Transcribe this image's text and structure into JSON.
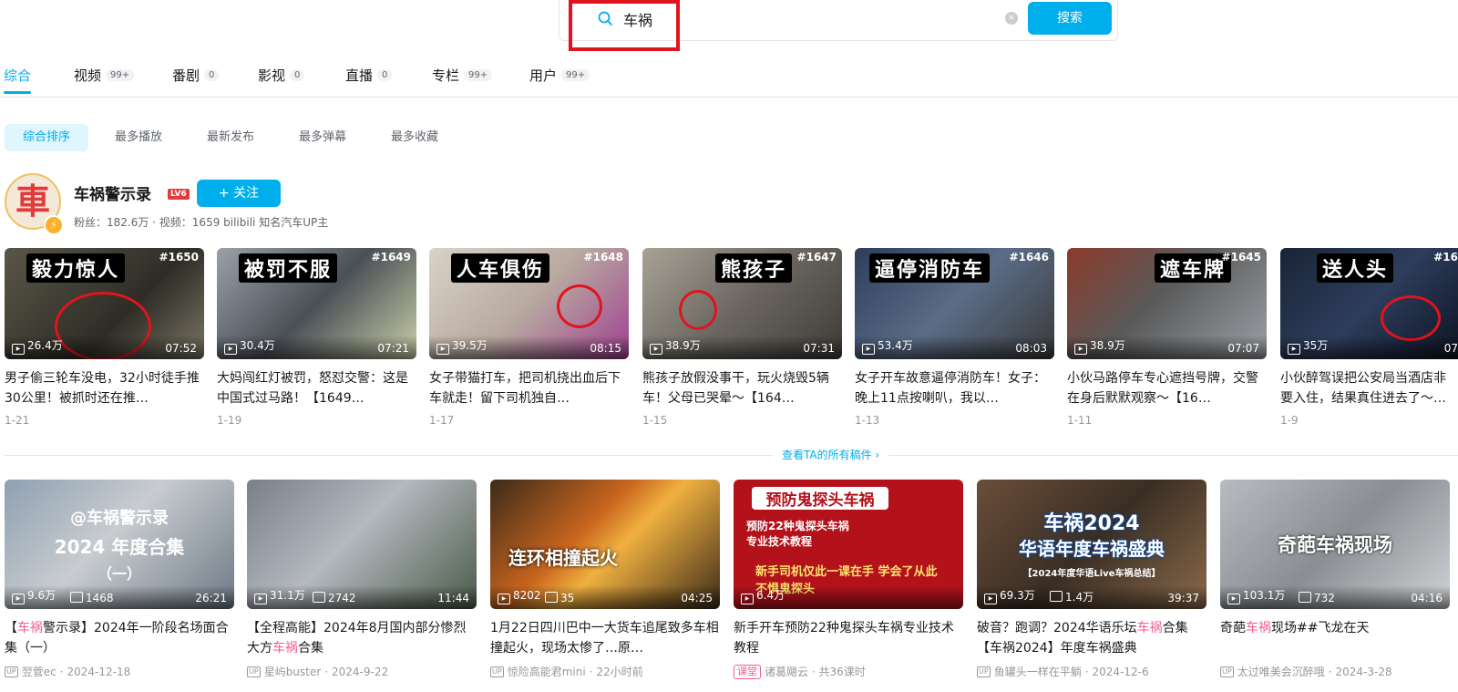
{
  "search": {
    "query": "车祸",
    "clear_label": "×",
    "button_label": "搜索"
  },
  "tabs": [
    {
      "label": "综合",
      "count": ""
    },
    {
      "label": "视频",
      "count": "99+"
    },
    {
      "label": "番剧",
      "count": "0"
    },
    {
      "label": "影视",
      "count": "0"
    },
    {
      "label": "直播",
      "count": "0"
    },
    {
      "label": "专栏",
      "count": "99+"
    },
    {
      "label": "用户",
      "count": "99+"
    }
  ],
  "sort_options": [
    "综合排序",
    "最多播放",
    "最新发布",
    "最多弹幕",
    "最多收藏"
  ],
  "uploader": {
    "avatar_char": "車",
    "name": "车祸警示录",
    "level": "LV6",
    "follow_label": "+ 关注",
    "stats": "粉丝：182.6万 · 视频：1659  bilibili 知名汽车UP主"
  },
  "uploader_videos": [
    {
      "caption": "毅力惊人",
      "num": "#1650",
      "plays": "26.4万",
      "duration": "07:52",
      "title": "男子偷三轮车没电，32小时徒手推30公里！被抓时还在推…",
      "date": "1-21"
    },
    {
      "caption": "被罚不服",
      "num": "#1649",
      "plays": "30.4万",
      "duration": "07:21",
      "title": "大妈闯红灯被罚，怒怼交警：这是中国式过马路！【1649…",
      "date": "1-19"
    },
    {
      "caption": "人车俱伤",
      "num": "#1648",
      "plays": "39.5万",
      "duration": "08:15",
      "title": "女子带猫打车，把司机挠出血后下车就走！留下司机独自…",
      "date": "1-17"
    },
    {
      "caption": "熊孩子",
      "num": "#1647",
      "plays": "38.9万",
      "duration": "07:31",
      "title": "熊孩子放假没事干，玩火烧毁5辆车！父母已哭晕～【164…",
      "date": "1-15"
    },
    {
      "caption": "逼停消防车",
      "num": "#1646",
      "plays": "53.4万",
      "duration": "08:03",
      "title": "女子开车故意逼停消防车！女子：晚上11点按喇叭，我以…",
      "date": "1-13"
    },
    {
      "caption": "遮车牌",
      "num": "#1645",
      "plays": "38.9万",
      "duration": "07:07",
      "title": "小伙马路停车专心遮挡号牌，交警在身后默默观察～【16…",
      "date": "1-11"
    },
    {
      "caption": "送人头",
      "num": "#16",
      "plays": "35万",
      "duration": "07",
      "title": "小伙醉驾误把公安局当酒店非要入住，结果真住进去了～…",
      "date": "1-9"
    }
  ],
  "see_all_label": "查看TA的所有稿件 ›",
  "results": [
    {
      "caption_top": "@车祸警示录",
      "caption_mid": "2024 年度合集",
      "caption_bot": "（一）",
      "plays": "9.6万",
      "danmaku": "1468",
      "duration": "26:21",
      "title_pre": "【",
      "title_hl": "车祸",
      "title_post": "警示录】2024年一阶段名场面合集（一）",
      "author": "翌菅ec",
      "date": "2024-12-18"
    },
    {
      "caption_top": "",
      "caption_mid": "",
      "caption_bot": "",
      "plays": "31.1万",
      "danmaku": "2742",
      "duration": "11:44",
      "title_pre": "【全程高能】2024年8月国内部分惨烈大方",
      "title_hl": "车祸",
      "title_post": "合集",
      "author": "星屿buster",
      "date": "2024-9-22"
    },
    {
      "caption_top": "连环相撞起火",
      "caption_mid": "",
      "caption_bot": "",
      "plays": "8202",
      "danmaku": "35",
      "duration": "04:25",
      "title_pre": "1月22日四川巴中一大货车追尾致多车相撞起火，现场太惨了…原…",
      "title_hl": "",
      "title_post": "",
      "author": "惊险高能君mini",
      "date": "22小时前"
    },
    {
      "caption_top": "预防鬼探头车祸",
      "caption_mid": "预防22种鬼探头车祸\n专业技术教程",
      "caption_bot": "新手司机仅此一课在手 学会了从此不惧鬼探头",
      "plays": "6.4万",
      "danmaku": "",
      "duration": "",
      "title_pre": "新手开车预防22种鬼探头车祸专业技术教程",
      "title_hl": "",
      "title_post": "",
      "author": "诸葛飓云 · 共36课时",
      "date": "",
      "tag": "课堂"
    },
    {
      "caption_top": "车祸2024",
      "caption_mid": "华语年度车祸盛典",
      "caption_bot": "【2024年度华语Live车祸总结】",
      "plays": "69.3万",
      "danmaku": "1.4万",
      "duration": "39:37",
      "title_pre": "破音？跑调？2024华语乐坛",
      "title_hl": "车祸",
      "title_post": "合集【车祸2024】年度车祸盛典",
      "author": "鱼罐头一样在平躺",
      "date": "2024-12-6"
    },
    {
      "caption_top": "奇葩车祸现场",
      "caption_mid": "",
      "caption_bot": "",
      "plays": "103.1万",
      "danmaku": "732",
      "duration": "04:16",
      "title_pre": "奇葩",
      "title_hl": "车祸",
      "title_post": "现场##飞龙在天",
      "author": "太过唯美会沉醉哦",
      "date": "2024-3-28"
    }
  ],
  "colors": {
    "accent": "#00aeec",
    "highlight": "#f25d8e",
    "annotation_red": "#e0141e"
  }
}
